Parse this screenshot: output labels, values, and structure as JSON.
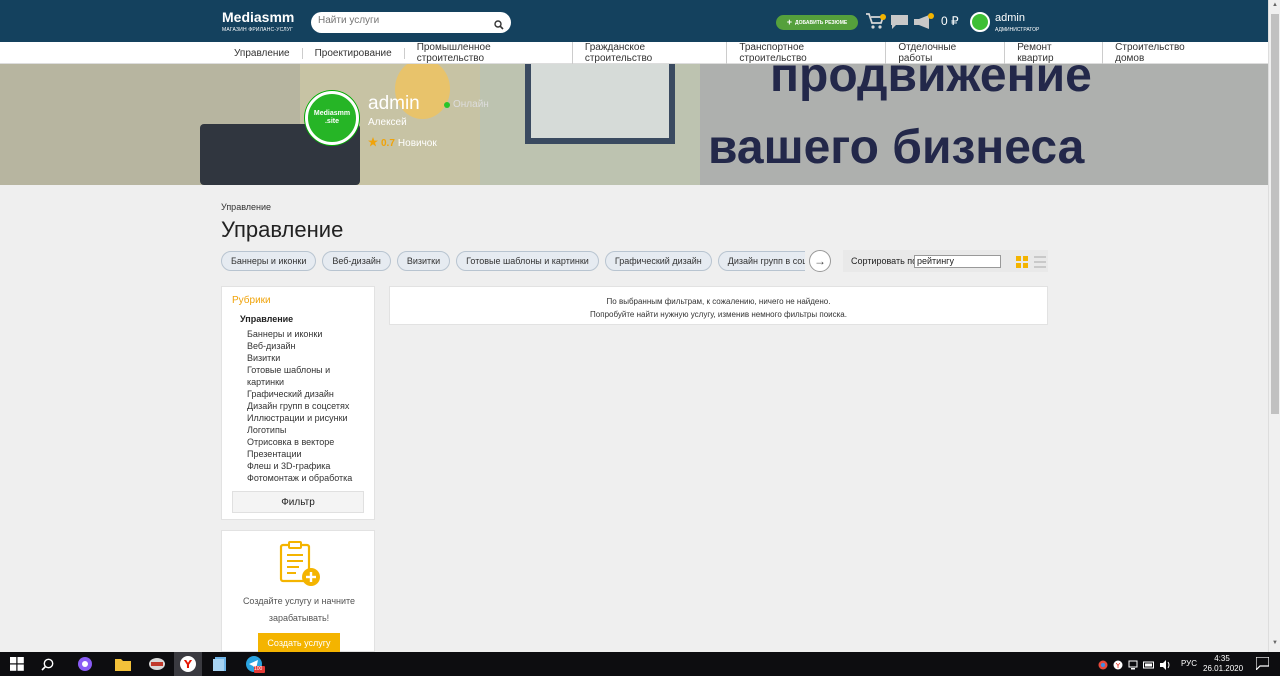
{
  "header": {
    "logo_title": "Mediasmm",
    "logo_subtitle": "МАГАЗИН ФРИЛАНС-УСЛУГ",
    "search_placeholder": "Найти услуги",
    "add_resume_label": "ДОБАВИТЬ РЕЗЮМЕ",
    "balance": "0 ₽",
    "user_name": "admin",
    "user_role": "АДМИНИСТРАТОР",
    "icons": [
      "cart-icon",
      "chat-icon",
      "megaphone-icon",
      "search-icon"
    ]
  },
  "nav": {
    "items": [
      "Управление",
      "Проектирование",
      "Промышленное строительство",
      "Гражданское строительство",
      "Транспортное строительство",
      "Отделочные работы",
      "Ремонт квартир",
      "Строительство домов"
    ]
  },
  "banner": {
    "line1": "продвижение",
    "line2": "вашего бизнеса"
  },
  "profile": {
    "avatar_line1": "Mediasmm",
    "avatar_line2": ".site",
    "name": "admin",
    "status": "Онлайн",
    "real_name": "Алексей",
    "rating": "0.7",
    "level": "Новичок"
  },
  "page": {
    "breadcrumb": "Управление",
    "title": "Управление",
    "chips": [
      "Баннеры и иконки",
      "Веб-дизайн",
      "Визитки",
      "Готовые шаблоны и картинки",
      "Графический дизайн",
      "Дизайн групп в соцсетях"
    ],
    "sort_label": "Сортировать по",
    "sort_value": "рейтингу"
  },
  "sidebar": {
    "title": "Рубрики",
    "active": "Управление",
    "items": [
      "Баннеры и иконки",
      "Веб-дизайн",
      "Визитки",
      "Готовые шаблоны и картинки",
      "Графический дизайн",
      "Дизайн групп в соцсетях",
      "Иллюстрации и рисунки",
      "Логотипы",
      "Отрисовка в векторе",
      "Презентации",
      "Флеш и 3D-графика",
      "Фотомонтаж и обработка"
    ],
    "filter_label": "Фильтр"
  },
  "results": {
    "line1": "По выбранным фильтрам, к сожалению, ничего не найдено.",
    "line2": "Попробуйте найти нужную услугу, изменив немного фильтры поиска."
  },
  "promo": {
    "text": "Создайте услугу и начните зарабатывать!",
    "button": "Создать услугу"
  },
  "taskbar": {
    "lang": "РУС",
    "time": "4:35",
    "date": "26.01.2020",
    "badge": "100"
  },
  "colors": {
    "header_bg": "#14415e",
    "accent_orange": "#f4b400",
    "accent_green": "#55a03c",
    "rubric_title": "#f0a30a"
  }
}
